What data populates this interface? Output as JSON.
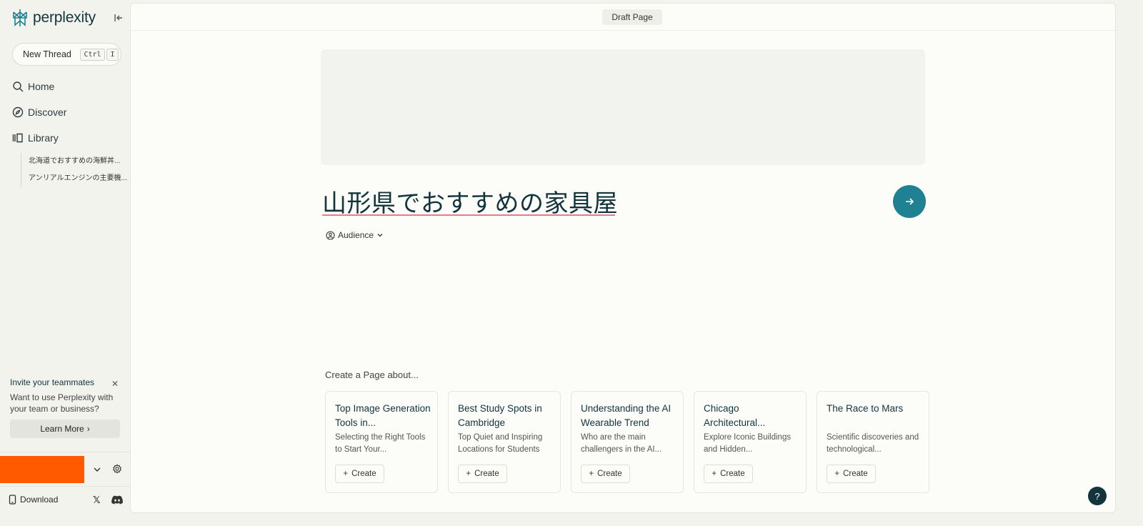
{
  "app": {
    "name": "perplexity"
  },
  "sidebar": {
    "new_thread": {
      "label": "New Thread",
      "shortcut_keys": [
        "Ctrl",
        "I"
      ]
    },
    "nav": [
      {
        "label": "Home",
        "icon": "search-icon"
      },
      {
        "label": "Discover",
        "icon": "compass-icon"
      },
      {
        "label": "Library",
        "icon": "library-icon"
      }
    ],
    "library_items": [
      "北海道でおすすめの海鮮丼...",
      "アンリアルエンジンの主要機..."
    ],
    "invite": {
      "title": "Invite your teammates",
      "text": "Want to use Perplexity with your team or business?",
      "button": "Learn More"
    },
    "footer": {
      "download": "Download"
    }
  },
  "main": {
    "badge": "Draft Page",
    "title": "山形県でおすすめの家具屋",
    "audience": "Audience",
    "create_heading": "Create a Page about...",
    "create_label": "Create",
    "cards": [
      {
        "title": "Top Image Generation Tools in...",
        "desc": "Selecting the Right Tools to Start Your..."
      },
      {
        "title": "Best Study Spots in Cambridge",
        "desc": "Top Quiet and Inspiring Locations for Students"
      },
      {
        "title": "Understanding the AI Wearable Trend",
        "desc": "Who are the main challengers in the AI..."
      },
      {
        "title": "Chicago Architectural...",
        "desc": "Explore Iconic Buildings and Hidden..."
      },
      {
        "title": "The Race to Mars",
        "desc": "Scientific discoveries and technological..."
      }
    ]
  },
  "help": "?",
  "colors": {
    "accent": "#1f8192",
    "brand_dark": "#13343b",
    "user_block": "#ff5a00",
    "underline": "#e77b8d"
  }
}
